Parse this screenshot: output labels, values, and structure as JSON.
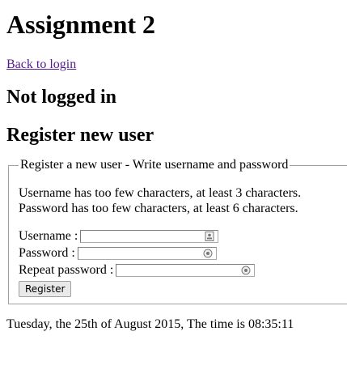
{
  "page": {
    "title": "Assignment 2",
    "back_link": "Back to login",
    "login_status": "Not logged in",
    "section_heading": "Register new user"
  },
  "form": {
    "legend": "Register a new user - Write username and password",
    "errors": [
      "Username has too few characters, at least 3 characters.",
      "Password has too few characters, at least 6 characters."
    ],
    "fields": {
      "username_label": "Username :",
      "username_value": "",
      "username_icon": "contact-card-icon",
      "password_label": "Password :",
      "password_value": "",
      "password_icon": "key-icon",
      "repeat_label": "Repeat password :",
      "repeat_value": "",
      "repeat_icon": "key-icon"
    },
    "submit_label": "Register"
  },
  "footer": {
    "datetime": "Tuesday, the 25th of August 2015, The time is 08:35:11"
  },
  "colors": {
    "link": "#551a8b",
    "fieldset_border": "#a0a0a0",
    "button_bg": "#e9e9e9"
  }
}
